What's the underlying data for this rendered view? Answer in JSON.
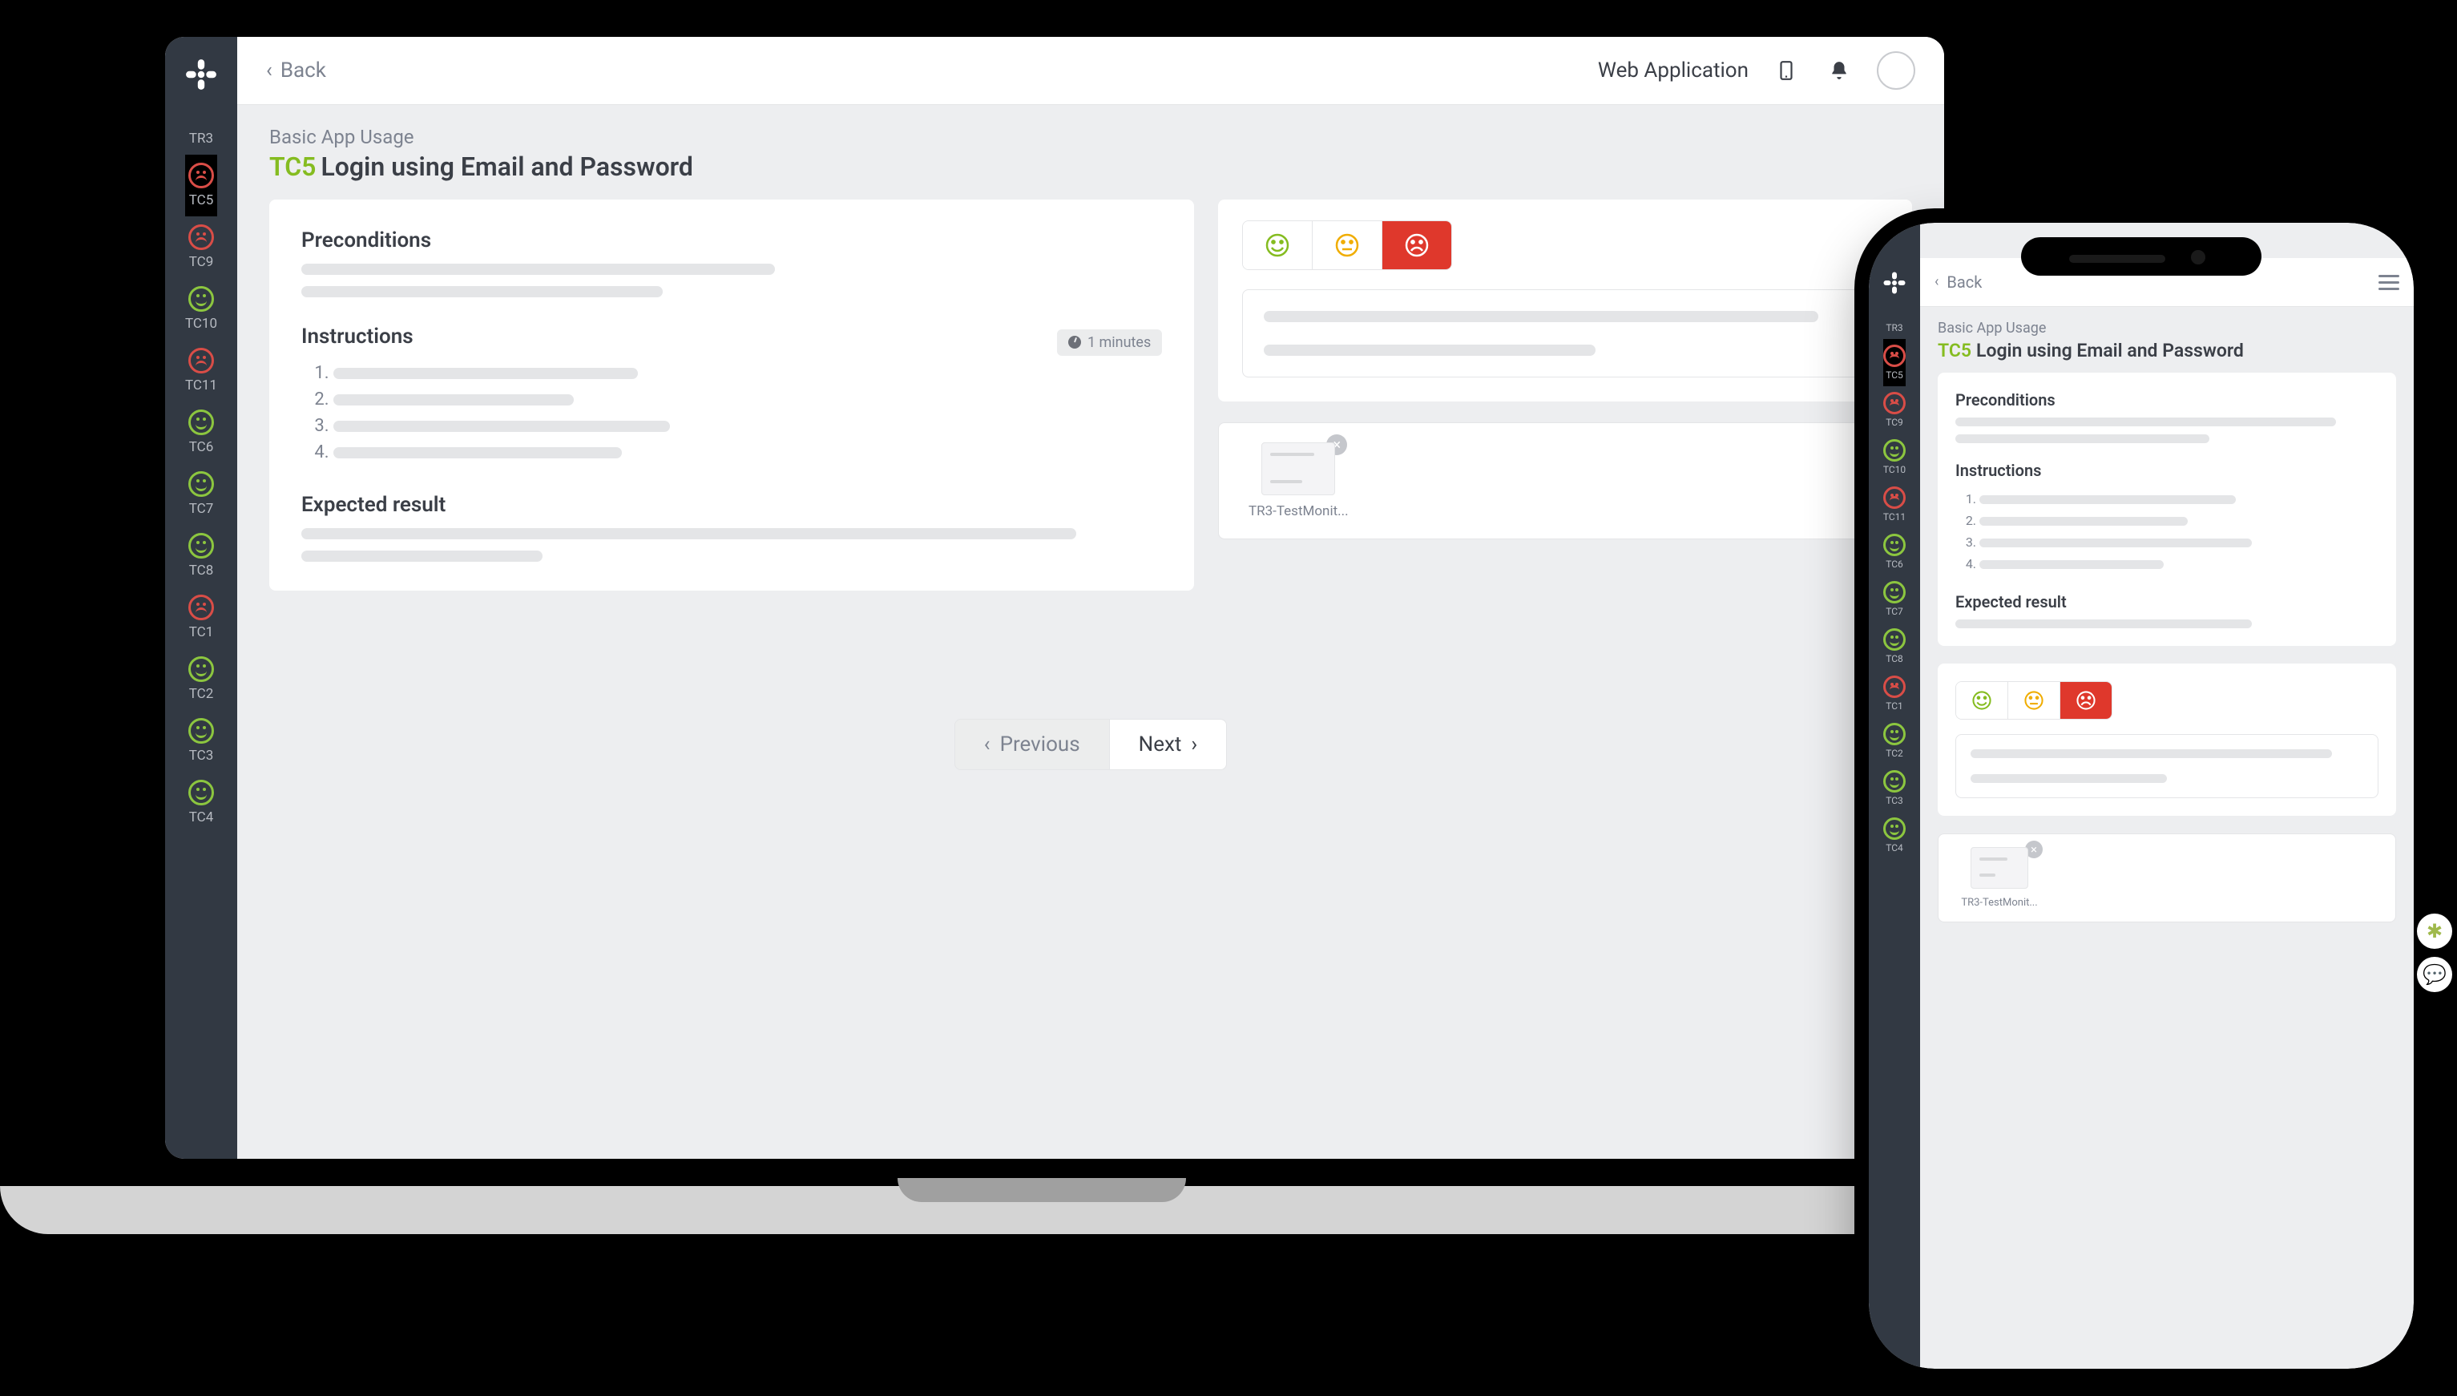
{
  "back_label": "Back",
  "project_name": "Web Application",
  "category": "Basic App Usage",
  "tc_code": "TC5",
  "tc_title": "Login using Email and Password",
  "duration": "1 minutes",
  "headings": {
    "preconditions": "Preconditions",
    "instructions": "Instructions",
    "expected": "Expected result"
  },
  "pager": {
    "prev": "Previous",
    "next": "Next"
  },
  "attachment_name": "TR3-TestMonit...",
  "sidebar": [
    {
      "id": "TR3",
      "status": "grey"
    },
    {
      "id": "TC5",
      "status": "red",
      "selected": true
    },
    {
      "id": "TC9",
      "status": "red"
    },
    {
      "id": "TC10",
      "status": "green"
    },
    {
      "id": "TC11",
      "status": "red"
    },
    {
      "id": "TC6",
      "status": "green"
    },
    {
      "id": "TC7",
      "status": "green"
    },
    {
      "id": "TC8",
      "status": "green"
    },
    {
      "id": "TC1",
      "status": "red"
    },
    {
      "id": "TC2",
      "status": "green"
    },
    {
      "id": "TC3",
      "status": "green"
    },
    {
      "id": "TC4",
      "status": "green"
    }
  ]
}
